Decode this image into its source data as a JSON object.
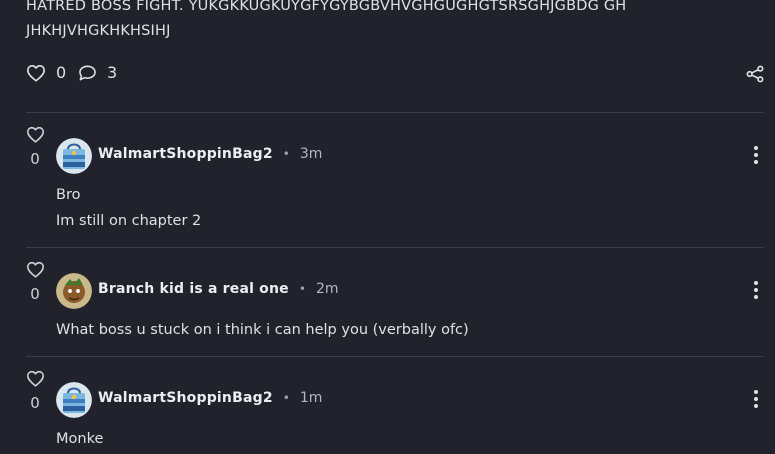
{
  "post": {
    "text": "HATRED BOSS FIGHT. YUKGKKUGKUYGFYGYBGBVHVGHGUGHGTSRSGHJGBDG GH JHKHJVHGKHKHSIHJ",
    "likes": "0",
    "comments": "3"
  },
  "comments": [
    {
      "username": "WalmartShoppinBag2",
      "time": "3m",
      "likes": "0",
      "lines": [
        "Bro",
        "Im still on chapter 2"
      ]
    },
    {
      "username": "Branch kid is a real one",
      "time": "2m",
      "likes": "0",
      "lines": [
        "What boss u stuck on i think i can help you (verbally ofc)"
      ]
    },
    {
      "username": "WalmartShoppinBag2",
      "time": "1m",
      "likes": "0",
      "lines": [
        "Monke"
      ]
    }
  ],
  "colors": {
    "background": "#21222c",
    "divider": "#3a3c48",
    "text": "#dfe1e8"
  },
  "icons": {
    "like": "heart-icon",
    "comment": "speech-bubble-icon",
    "share": "share-icon",
    "more": "kebab-menu-icon"
  }
}
